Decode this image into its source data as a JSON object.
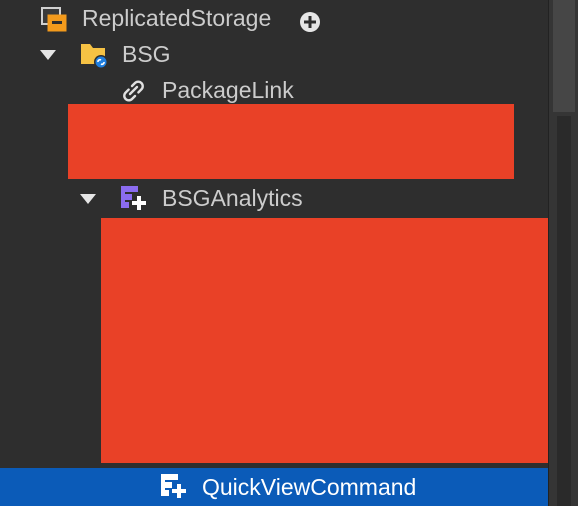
{
  "explorer": {
    "rows": [
      {
        "label": "ReplicatedStorage",
        "icon": "replicated-storage-icon",
        "action_icon": "add-icon"
      },
      {
        "label": "BSG",
        "icon": "package-folder-icon"
      },
      {
        "label": "PackageLink",
        "icon": "link-icon"
      },
      {
        "label": "BSGAnalytics",
        "icon": "module-script-icon"
      },
      {
        "label": "QuickViewCommand",
        "icon": "module-script-icon"
      }
    ],
    "selected_row": "QuickViewCommand"
  },
  "colors": {
    "background": "#2e2e2e",
    "text": "#cccccc",
    "selection": "#0b5bb8",
    "redaction": "#e94127",
    "folder": "#f6c244",
    "module_icon": "#8b6cf0",
    "storage_icon": "#f39a1c"
  }
}
